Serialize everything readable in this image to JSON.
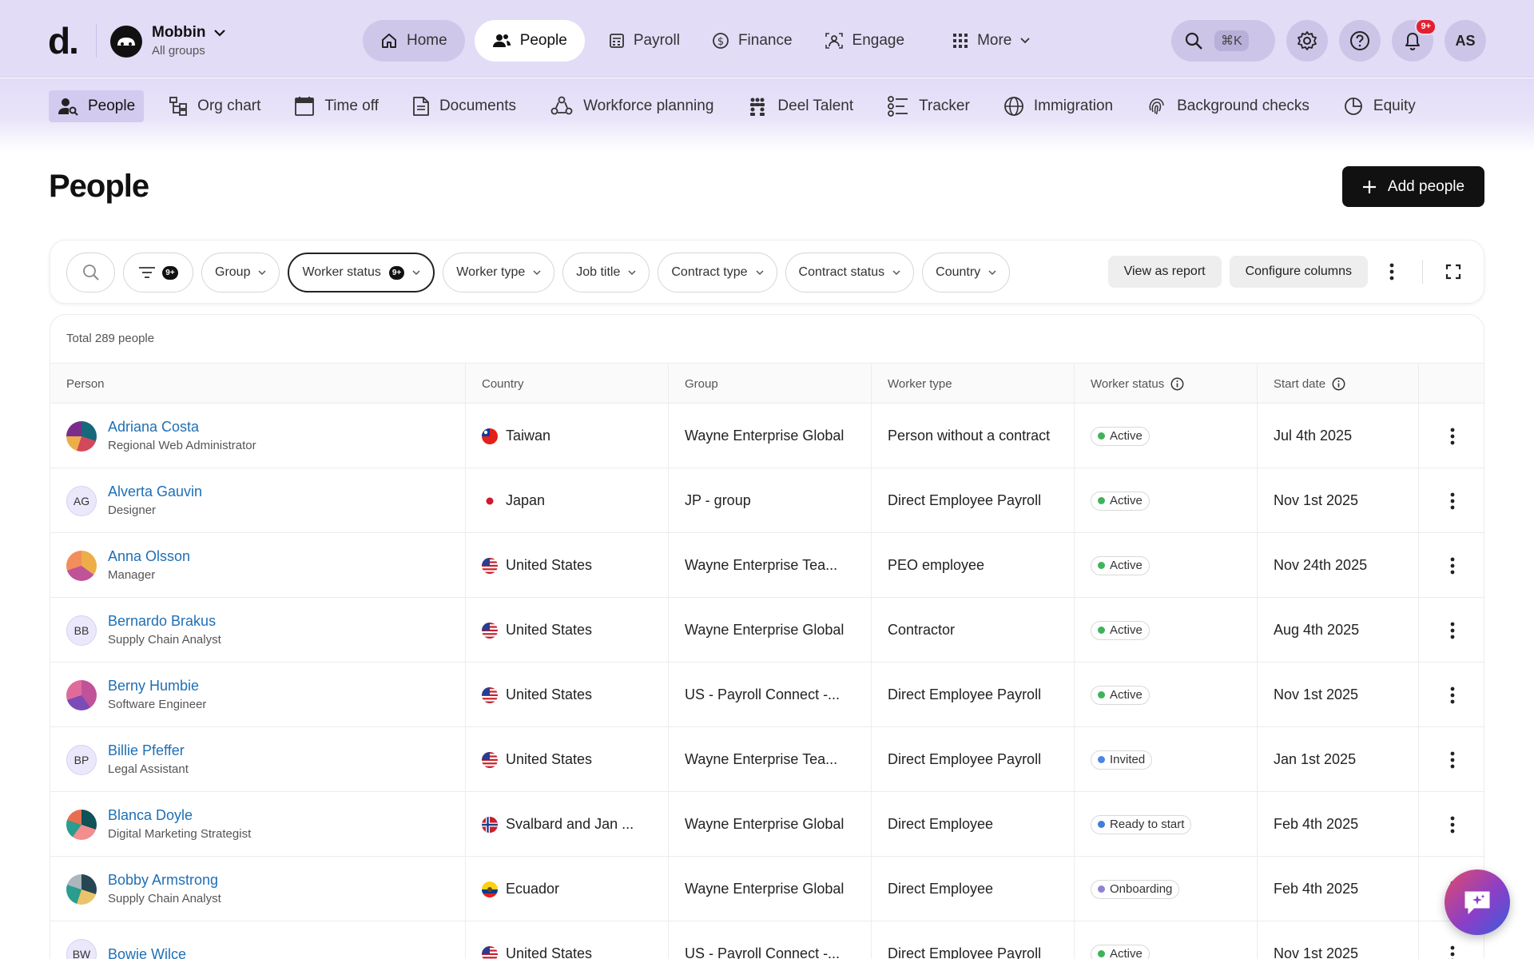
{
  "app": {
    "logo": "d.",
    "org_name": "Mobbin",
    "org_sub": "All groups",
    "user_initials": "AS",
    "notif_count": "9+",
    "search_shortcut": "⌘K"
  },
  "main_nav": [
    {
      "label": "Home",
      "icon": "home-icon"
    },
    {
      "label": "People",
      "icon": "people-icon"
    },
    {
      "label": "Payroll",
      "icon": "payroll-icon"
    },
    {
      "label": "Finance",
      "icon": "dollar-icon"
    },
    {
      "label": "Engage",
      "icon": "engage-icon"
    },
    {
      "label": "More",
      "icon": "grid-icon"
    }
  ],
  "sub_nav": [
    {
      "label": "People",
      "icon": "person-search-icon"
    },
    {
      "label": "Org chart",
      "icon": "org-chart-icon"
    },
    {
      "label": "Time off",
      "icon": "calendar-icon"
    },
    {
      "label": "Documents",
      "icon": "document-icon"
    },
    {
      "label": "Workforce planning",
      "icon": "workforce-icon"
    },
    {
      "label": "Deel Talent",
      "icon": "talent-icon"
    },
    {
      "label": "Tracker",
      "icon": "tracker-icon"
    },
    {
      "label": "Immigration",
      "icon": "globe-icon"
    },
    {
      "label": "Background checks",
      "icon": "fingerprint-icon"
    },
    {
      "label": "Equity",
      "icon": "pie-icon"
    }
  ],
  "page": {
    "title": "People",
    "add_button": "Add people"
  },
  "filters": {
    "filter_count": "9+",
    "worker_status_count": "9+",
    "pills": [
      "Group",
      "Worker status",
      "Worker type",
      "Job title",
      "Contract type",
      "Contract status",
      "Country"
    ],
    "view_as_report": "View as report",
    "configure_columns": "Configure columns"
  },
  "table": {
    "total": "Total 289 people",
    "columns": [
      "Person",
      "Country",
      "Group",
      "Worker type",
      "Worker status",
      "Start date"
    ],
    "rows": [
      {
        "name": "Adriana Costa",
        "title": "Regional Web Administrator",
        "avatar": "",
        "country": "Taiwan",
        "group": "Wayne Enterprise Global",
        "worker_type": "Person without a contract",
        "status": "Active",
        "start": "Jul 4th 2025"
      },
      {
        "name": "Alverta Gauvin",
        "title": "Designer",
        "avatar": "AG",
        "country": "Japan",
        "group": "JP - group",
        "worker_type": "Direct Employee Payroll",
        "status": "Active",
        "start": "Nov 1st 2025"
      },
      {
        "name": "Anna Olsson",
        "title": "Manager",
        "avatar": "",
        "country": "United States",
        "group": "Wayne Enterprise Tea...",
        "worker_type": "PEO employee",
        "status": "Active",
        "start": "Nov 24th 2025"
      },
      {
        "name": "Bernardo Brakus",
        "title": "Supply Chain Analyst",
        "avatar": "BB",
        "country": "United States",
        "group": "Wayne Enterprise Global",
        "worker_type": "Contractor",
        "status": "Active",
        "start": "Aug 4th 2025"
      },
      {
        "name": "Berny Humbie",
        "title": "Software Engineer",
        "avatar": "",
        "country": "United States",
        "group": "US - Payroll Connect -...",
        "worker_type": "Direct Employee Payroll",
        "status": "Active",
        "start": "Nov 1st 2025"
      },
      {
        "name": "Billie Pfeffer",
        "title": "Legal Assistant",
        "avatar": "BP",
        "country": "United States",
        "group": "Wayne Enterprise Tea...",
        "worker_type": "Direct Employee Payroll",
        "status": "Invited",
        "start": "Jan 1st 2025"
      },
      {
        "name": "Blanca Doyle",
        "title": "Digital Marketing Strategist",
        "avatar": "",
        "country": "Svalbard and Jan ...",
        "group": "Wayne Enterprise Global",
        "worker_type": "Direct Employee",
        "status": "Ready to start",
        "start": "Feb 4th 2025"
      },
      {
        "name": "Bobby Armstrong",
        "title": "Supply Chain Analyst",
        "avatar": "",
        "country": "Ecuador",
        "group": "Wayne Enterprise Global",
        "worker_type": "Direct Employee",
        "status": "Onboarding",
        "start": "Feb 4th 2025"
      },
      {
        "name": "Bowie Wilce",
        "title": "",
        "avatar": "BW",
        "country": "United States",
        "group": "US - Payroll Connect -...",
        "worker_type": "Direct Employee Payroll",
        "status": "Active",
        "start": "Nov 1st 2025"
      }
    ]
  },
  "colors": {
    "topbar_bg": "#e2dcf7",
    "link_blue": "#1f6fb5",
    "active_green": "#3fb35b",
    "invited_blue": "#4a86e8",
    "ready_blue": "#3d7fdb",
    "onboarding_purple": "#8c83d6"
  }
}
